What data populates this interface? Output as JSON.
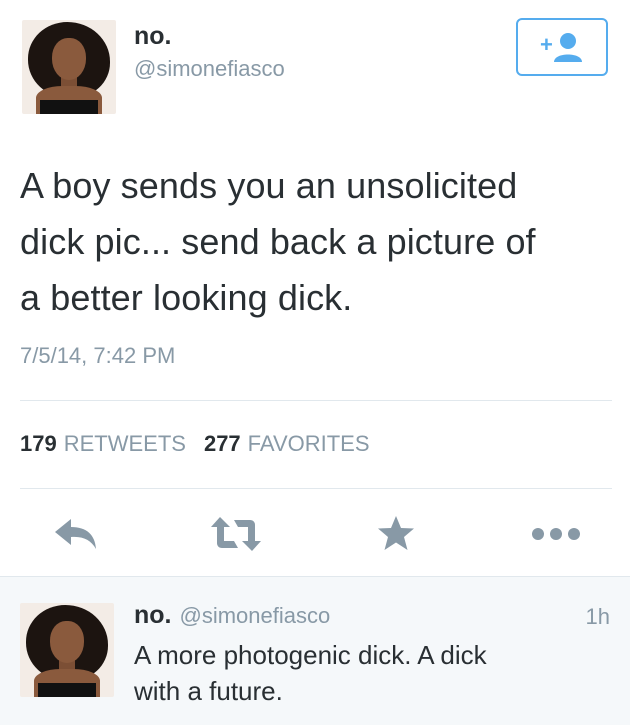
{
  "tweet": {
    "author_name": "no.",
    "author_handle": "@simonefiasco",
    "text_lines": [
      "A boy sends you an unsolicited",
      "dick pic... send back a picture of",
      "a better looking dick."
    ],
    "timestamp": "7/5/14, 7:42 PM",
    "retweets_count": "179",
    "retweets_label": "RETWEETS",
    "favorites_count": "277",
    "favorites_label": "FAVORITES"
  },
  "follow_button_icon": "add-user-icon",
  "actions": [
    "reply-icon",
    "retweet-icon",
    "favorite-star-icon",
    "more-dots-icon"
  ],
  "reply": {
    "author_name": "no.",
    "author_handle": "@simonefiasco",
    "time": "1h",
    "text_lines": [
      "A more photogenic dick. A dick",
      "with a future."
    ]
  },
  "colors": {
    "accent": "#55acee",
    "icon_gray": "#8899a6",
    "text": "#292f33",
    "reply_bg": "#f5f8fa"
  }
}
